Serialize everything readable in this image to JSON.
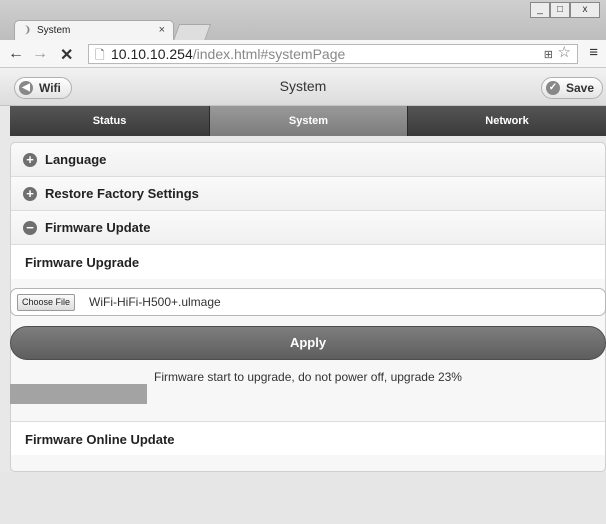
{
  "browser": {
    "tab_title": "System",
    "tab_close": "×",
    "window_controls": {
      "minimize": "_",
      "maximize": "□",
      "close": "x"
    },
    "nav": {
      "back": "←",
      "forward": "→",
      "stop": "✕"
    },
    "url_host": "10.10.10.254",
    "url_path": "/index.html#systemPage",
    "icons": [
      "page-icon",
      "translate-icon",
      "star-icon",
      "menu-icon"
    ]
  },
  "header": {
    "left_button": "Wifi",
    "title": "System",
    "right_button": "Save"
  },
  "navbar": {
    "tabs": [
      {
        "label": "Status"
      },
      {
        "label": "System"
      },
      {
        "label": "Network"
      }
    ],
    "active": "System"
  },
  "sections": {
    "language": "Language",
    "restore": "Restore Factory Settings",
    "firmware_update": "Firmware Update",
    "firmware_upgrade": "Firmware Upgrade",
    "firmware_online": "Firmware Online Update"
  },
  "file": {
    "button": "Choose File",
    "filename": "WiFi-HiFi-H500+.ulmage"
  },
  "apply": "Apply",
  "status": {
    "text": "Firmware start to upgrade,  do not power off, upgrade 23%",
    "progress_percent": 23
  },
  "colors": {
    "navbar_active": "#8a8a8a",
    "navbar_bg": "#484848",
    "apply_bg": "#6e6e6e",
    "progress_fill": "#a3a3a3"
  }
}
